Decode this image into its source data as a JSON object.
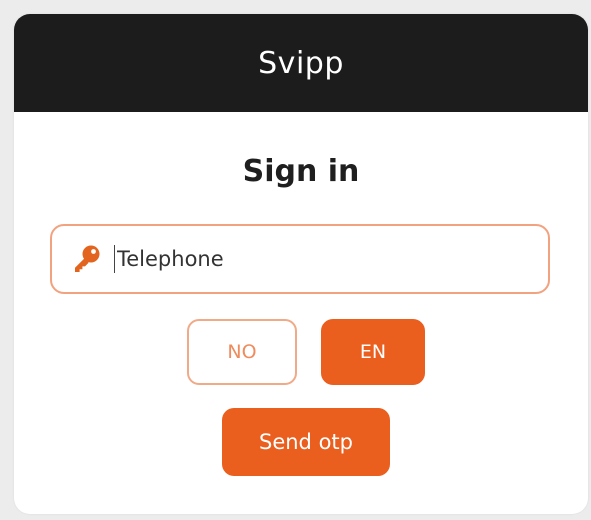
{
  "app": {
    "title": "Svipp"
  },
  "signin": {
    "heading": "Sign in",
    "phone_placeholder": "Telephone",
    "phone_value": ""
  },
  "language": {
    "options": [
      {
        "code": "NO",
        "selected": false
      },
      {
        "code": "EN",
        "selected": true
      }
    ]
  },
  "actions": {
    "send_otp_label": "Send otp"
  },
  "icons": {
    "phone_field_icon": "key-icon"
  },
  "colors": {
    "accent": "#ea5e1e",
    "accent_light_border": "#f2a27f",
    "header_bg": "#1c1c1c"
  }
}
